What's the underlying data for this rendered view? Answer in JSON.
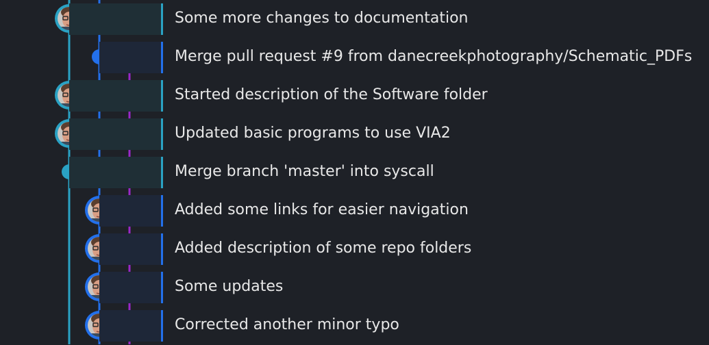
{
  "colors": {
    "background": "#1e2127",
    "lane_teal": "#2aa2c4",
    "lane_blue": "#2370eb",
    "lane_purple": "#9a28c9",
    "row_teal_bg": "#1f2f36",
    "row_blue_bg": "#1e2738",
    "text": "#e8e8e8"
  },
  "commits": [
    {
      "message": "Some more changes to documentation",
      "lane": "teal",
      "node": "avatar"
    },
    {
      "message": "Merge pull request #9 from danecreekphotography/Schematic_PDFs",
      "lane": "blue",
      "node": "dot"
    },
    {
      "message": "Started description of the Software folder",
      "lane": "teal",
      "node": "avatar"
    },
    {
      "message": "Updated basic programs to use VIA2",
      "lane": "teal",
      "node": "avatar"
    },
    {
      "message": "Merge branch 'master' into syscall",
      "lane": "teal",
      "node": "dot"
    },
    {
      "message": "Added some links for easier navigation",
      "lane": "blue",
      "node": "avatar"
    },
    {
      "message": "Added description of some repo folders",
      "lane": "blue",
      "node": "avatar"
    },
    {
      "message": "Some updates",
      "lane": "blue",
      "node": "avatar"
    },
    {
      "message": "Corrected another minor typo",
      "lane": "blue",
      "node": "avatar"
    }
  ]
}
